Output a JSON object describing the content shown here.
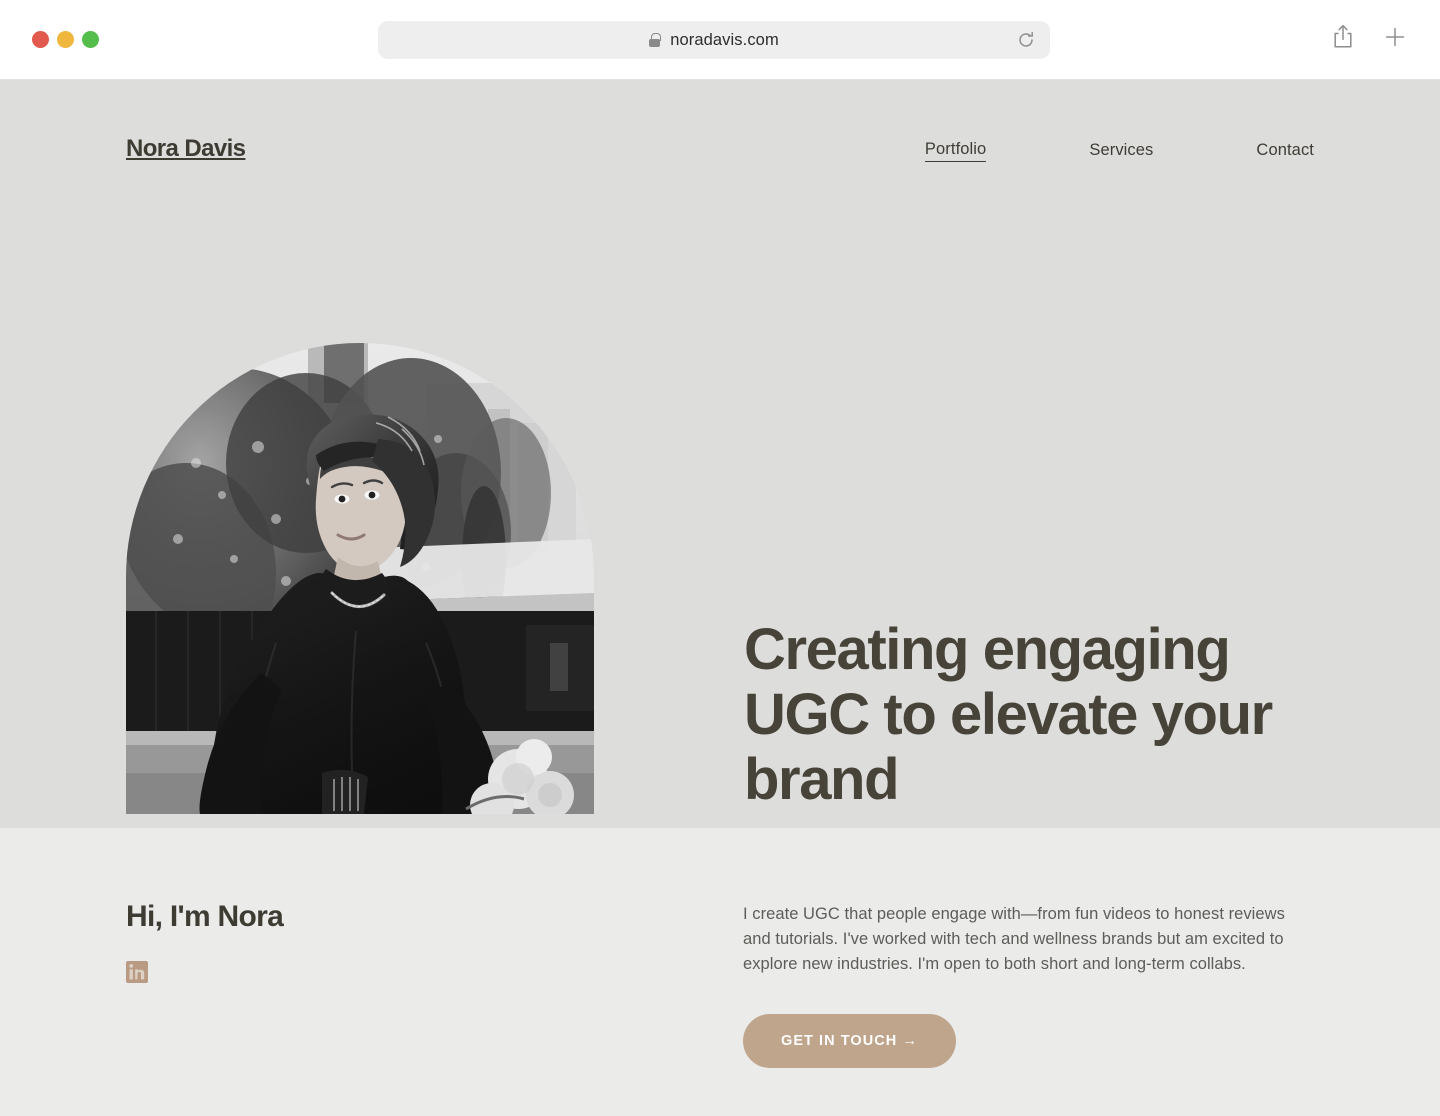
{
  "browser": {
    "url": "noradavis.com",
    "lock_icon": "lock-icon",
    "reload_icon": "reload-icon",
    "share_icon": "share-icon",
    "new_tab_icon": "plus-icon",
    "traffic_lights": [
      {
        "name": "close",
        "color": "#e2594e"
      },
      {
        "name": "minimize",
        "color": "#f0b73e"
      },
      {
        "name": "maximize",
        "color": "#54bd4c"
      }
    ]
  },
  "site": {
    "brand": "Nora Davis",
    "nav": [
      {
        "label": "Portfolio",
        "active": true
      },
      {
        "label": "Services",
        "active": false
      },
      {
        "label": "Contact",
        "active": false
      }
    ]
  },
  "hero": {
    "heading": "Creating engaging UGC to elevate your brand",
    "portrait_alt": "black-and-white arch portrait of Nora",
    "background_color": "#dddddc",
    "heading_color": "#474339"
  },
  "about": {
    "title": "Hi, I'm Nora",
    "social": [
      {
        "name": "linkedin-icon",
        "label": "LinkedIn",
        "color": "#b89b82"
      }
    ],
    "body": "I create UGC that people engage with—from fun videos to honest reviews and tutorials. I've worked with tech and wellness brands but am excited to explore new industries. I'm open to both short and long-term collabs.",
    "cta_label": "GET IN TOUCH →",
    "cta_color": "#bfa58b",
    "background_color": "#ebebea"
  }
}
